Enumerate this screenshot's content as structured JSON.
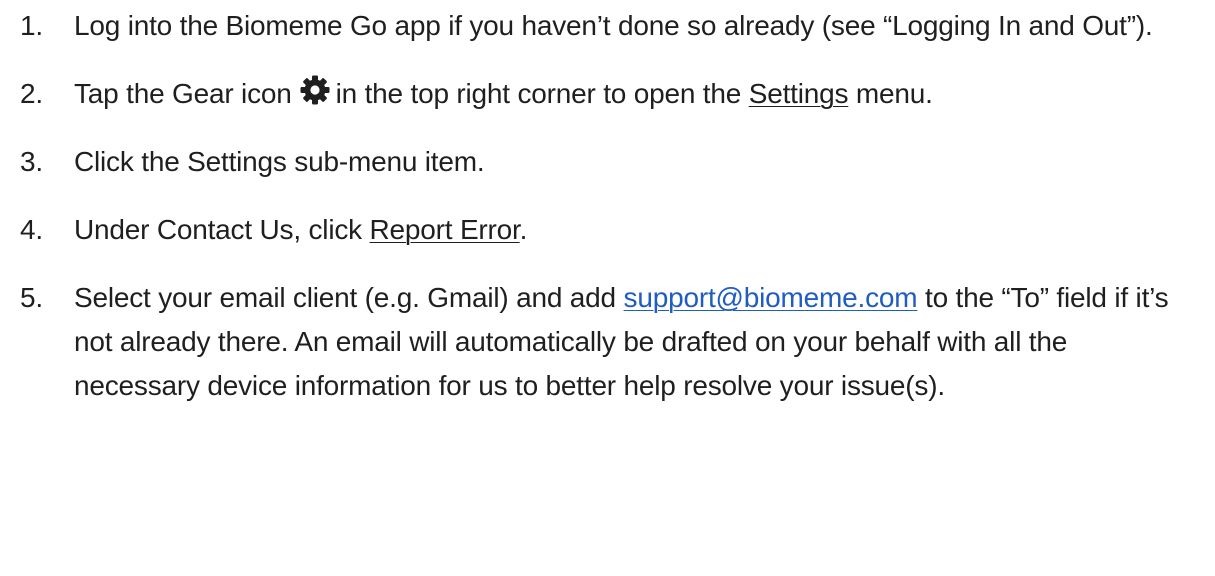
{
  "steps": [
    {
      "number": "1.",
      "text": "Log into the Biomeme Go app if you haven’t done so already (see “Logging In and Out”)."
    },
    {
      "number": "2.",
      "text_before_icon": "Tap the Gear icon",
      "icon": "gear-icon",
      "text_after_icon": "in the top right corner to open the",
      "settings_link": "Settings",
      "text_end": "menu."
    },
    {
      "number": "3.",
      "text": "Click the Settings sub-menu item."
    },
    {
      "number": "4.",
      "text_before": "Under Contact Us, click",
      "report_error": "Report Error",
      "text_after": "."
    },
    {
      "number": "5.",
      "text_before": "Select your email client (e.g. Gmail) and add",
      "email_link": "support@biomeme.com",
      "text_after": "to the “To” field if it’s not already there. An email will automatically be drafted on your behalf with all the necessary device information for us to better help resolve your issue(s)."
    }
  ],
  "colors": {
    "text": "#1f1f1f",
    "link": "#1f5cc4"
  }
}
